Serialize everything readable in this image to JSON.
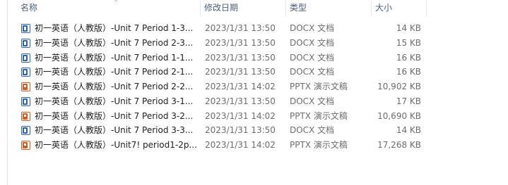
{
  "columns": {
    "name": "名称",
    "date": "修改日期",
    "type": "类型",
    "size": "大小"
  },
  "files": [
    {
      "icon": "word-doc-icon",
      "kind": "docx",
      "name": "初一英语（人教版）-Unit 7  Period 1-3...",
      "date": "2023/1/31 13:50",
      "type": "DOCX 文档",
      "size": "14 KB"
    },
    {
      "icon": "word-doc-icon",
      "kind": "docx",
      "name": "初一英语（人教版）-Unit 7  Period 2-3...",
      "date": "2023/1/31 13:50",
      "type": "DOCX 文档",
      "size": "15 KB"
    },
    {
      "icon": "word-doc-icon",
      "kind": "docx",
      "name": "初一英语（人教版）-Unit 7 Period 1-1...",
      "date": "2023/1/31 13:50",
      "type": "DOCX 文档",
      "size": "16 KB"
    },
    {
      "icon": "word-doc-icon",
      "kind": "docx",
      "name": "初一英语（人教版）-Unit 7 Period 2-1...",
      "date": "2023/1/31 13:50",
      "type": "DOCX 文档",
      "size": "16 KB"
    },
    {
      "icon": "powerpoint-icon",
      "kind": "pptx",
      "name": "初一英语（人教版）-Unit 7 Period 2-2...",
      "date": "2023/1/31 14:02",
      "type": "PPTX 演示文稿",
      "size": "10,902 KB"
    },
    {
      "icon": "word-doc-icon",
      "kind": "docx",
      "name": "初一英语（人教版）-Unit 7 Period 3-1...",
      "date": "2023/1/31 13:50",
      "type": "DOCX 文档",
      "size": "17 KB"
    },
    {
      "icon": "powerpoint-icon",
      "kind": "pptx",
      "name": "初一英语（人教版）-Unit 7 Period 3-2...",
      "date": "2023/1/31 14:02",
      "type": "PPTX 演示文稿",
      "size": "10,690 KB"
    },
    {
      "icon": "word-doc-icon",
      "kind": "docx",
      "name": "初一英语（人教版）-Unit 7 Period 3-3...",
      "date": "2023/1/31 13:50",
      "type": "DOCX 文档",
      "size": "14 KB"
    },
    {
      "icon": "powerpoint-icon",
      "kind": "pptx",
      "name": "初一英语（人教版）-Unit7! period1-2p...",
      "date": "2023/1/31 14:02",
      "type": "PPTX 演示文稿",
      "size": "17,268 KB"
    }
  ]
}
